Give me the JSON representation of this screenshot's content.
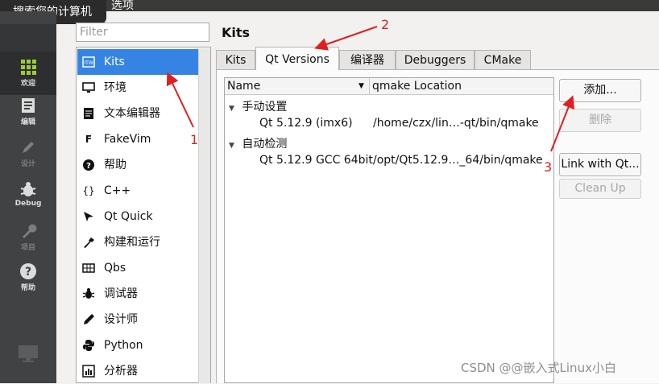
{
  "window": {
    "title": "选项",
    "tooltip": "搜索您的计算机"
  },
  "modebar": {
    "items": [
      {
        "label": "欢迎",
        "icon": "grid-icon"
      },
      {
        "label": "编辑",
        "icon": "edit-icon"
      },
      {
        "label": "设计",
        "icon": "pencil-icon"
      },
      {
        "label": "Debug",
        "icon": "bug-icon"
      },
      {
        "label": "项目",
        "icon": "wrench-icon"
      },
      {
        "label": "帮助",
        "icon": "help-icon"
      }
    ]
  },
  "filter": {
    "placeholder": "Filter"
  },
  "categories": [
    {
      "label": "Kits",
      "icon": "kits-icon",
      "selected": true
    },
    {
      "label": "环境",
      "icon": "monitor-icon"
    },
    {
      "label": "文本编辑器",
      "icon": "text-editor-icon"
    },
    {
      "label": "FakeVim",
      "icon": "fakevim-icon"
    },
    {
      "label": "帮助",
      "icon": "help-icon"
    },
    {
      "label": "C++",
      "icon": "braces-icon"
    },
    {
      "label": "Qt Quick",
      "icon": "qtquick-icon"
    },
    {
      "label": "构建和运行",
      "icon": "hammer-icon"
    },
    {
      "label": "Qbs",
      "icon": "qbs-icon"
    },
    {
      "label": "调试器",
      "icon": "bug-icon"
    },
    {
      "label": "设计师",
      "icon": "pen-icon"
    },
    {
      "label": "Python",
      "icon": "python-icon"
    },
    {
      "label": "分析器",
      "icon": "analyzer-icon"
    }
  ],
  "page_title": "Kits",
  "tabs": [
    {
      "label": "Kits"
    },
    {
      "label": "Qt Versions",
      "active": true
    },
    {
      "label": "编译器"
    },
    {
      "label": "Debuggers"
    },
    {
      "label": "CMake"
    }
  ],
  "tree": {
    "columns": [
      "Name",
      "qmake Location"
    ],
    "groups": [
      {
        "label": "手动设置",
        "rows": [
          {
            "name": "Qt 5.12.9 (imx6)",
            "location": "/home/czx/lin…-qt/bin/qmake"
          }
        ]
      },
      {
        "label": "自动检测",
        "rows": [
          {
            "name": "Qt 5.12.9 GCC 64bit",
            "location": "/opt/Qt5.12.9…_64/bin/qmake"
          }
        ]
      }
    ]
  },
  "buttons": {
    "add": "添加...",
    "remove": "删除",
    "link": "Link with Qt...",
    "cleanup": "Clean Up"
  },
  "annotations": {
    "n1": "1",
    "n2": "2",
    "n3": "3",
    "color": "#e02020"
  },
  "watermark": "CSDN @@嵌入式Linux小白"
}
